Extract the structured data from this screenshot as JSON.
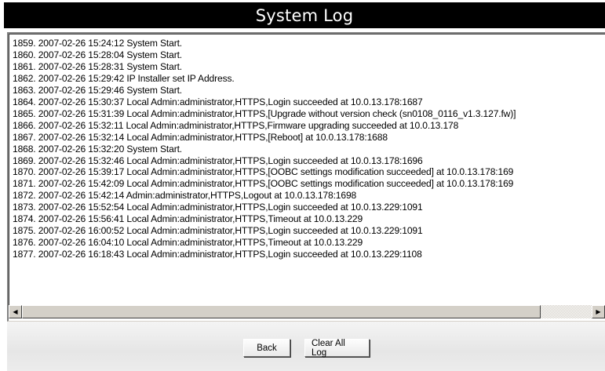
{
  "header": {
    "title": "System Log"
  },
  "log": {
    "entries": [
      "1859. 2007-02-26 15:24:12  System Start.",
      "1860. 2007-02-26 15:28:04  System Start.",
      "1861. 2007-02-26 15:28:31  System Start.",
      "1862. 2007-02-26 15:29:42  IP Installer set IP Address.",
      "1863. 2007-02-26 15:29:46  System Start.",
      "1864. 2007-02-26 15:30:37  Local Admin:administrator,HTTPS,Login succeeded at 10.0.13.178:1687",
      "1865. 2007-02-26 15:31:39  Local Admin:administrator,HTTPS,[Upgrade without version check (sn0108_0116_v1.3.127.fw)]",
      "1866. 2007-02-26 15:32:11  Local Admin:administrator,HTTPS,Firmware upgrading succeeded at 10.0.13.178",
      "1867. 2007-02-26 15:32:14  Local Admin:administrator,HTTPS,[Reboot] at 10.0.13.178:1688",
      "1868. 2007-02-26 15:32:20  System Start.",
      "1869. 2007-02-26 15:32:46  Local Admin:administrator,HTTPS,Login succeeded at 10.0.13.178:1696",
      "1870. 2007-02-26 15:39:17  Local Admin:administrator,HTTPS,[OOBC settings modification succeeded] at 10.0.13.178:169",
      "1871. 2007-02-26 15:42:09  Local Admin:administrator,HTTPS,[OOBC settings modification succeeded] at 10.0.13.178:169",
      "1872. 2007-02-26 15:42:14  Admin:administrator,HTTPS,Logout  at 10.0.13.178:1698",
      "1873. 2007-02-26 15:52:54  Local Admin:administrator,HTTPS,Login succeeded at 10.0.13.229:1091",
      "1874. 2007-02-26 15:56:41  Local Admin:administrator,HTTPS,Timeout at 10.0.13.229",
      "1875. 2007-02-26 16:00:52  Local Admin:administrator,HTTPS,Login succeeded at 10.0.13.229:1091",
      "1876. 2007-02-26 16:04:10  Local Admin:administrator,HTTPS,Timeout at 10.0.13.229",
      "1877. 2007-02-26 16:18:43  Local Admin:administrator,HTTPS,Login succeeded at 10.0.13.229:1108"
    ],
    "scrollbar": {
      "left_arrow_icon": "scroll-left-arrow",
      "right_arrow_icon": "scroll-right-arrow",
      "left_arrow_glyph": "◀",
      "right_arrow_glyph": "▶",
      "scroll_position": 0,
      "visible_fraction": 0.91
    }
  },
  "actions": {
    "back_label": "Back",
    "clear_label": "Clear All Log"
  },
  "colors": {
    "title_bar_bg": "#000000",
    "title_text": "#ffffff",
    "log_bg": "#ffffff",
    "panel_bg": "#e9e9e9"
  }
}
